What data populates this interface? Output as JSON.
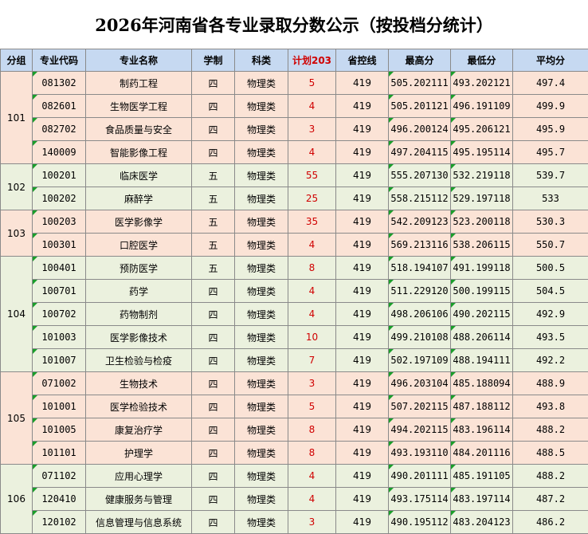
{
  "title": "2026年河南省各专业录取分数公示（按投档分统计）",
  "headers": [
    "分组",
    "专业代码",
    "专业名称",
    "学制",
    "科类",
    "计划203",
    "省控线",
    "最高分",
    "最低分",
    "平均分"
  ],
  "groups": [
    {
      "id": "101",
      "rows": [
        {
          "code": "081302",
          "name": "制药工程",
          "years": "四",
          "subject": "物理类",
          "plan": "5",
          "line": "419",
          "max": "505.202111",
          "min": "493.202121",
          "avg": "497.4"
        },
        {
          "code": "082601",
          "name": "生物医学工程",
          "years": "四",
          "subject": "物理类",
          "plan": "4",
          "line": "419",
          "max": "505.201121",
          "min": "496.191109",
          "avg": "499.9"
        },
        {
          "code": "082702",
          "name": "食品质量与安全",
          "years": "四",
          "subject": "物理类",
          "plan": "3",
          "line": "419",
          "max": "496.200124",
          "min": "495.206121",
          "avg": "495.9"
        },
        {
          "code": "140009",
          "name": "智能影像工程",
          "years": "四",
          "subject": "物理类",
          "plan": "4",
          "line": "419",
          "max": "497.204115",
          "min": "495.195114",
          "avg": "495.7"
        }
      ]
    },
    {
      "id": "102",
      "rows": [
        {
          "code": "100201",
          "name": "临床医学",
          "years": "五",
          "subject": "物理类",
          "plan": "55",
          "line": "419",
          "max": "555.207130",
          "min": "532.219118",
          "avg": "539.7"
        },
        {
          "code": "100202",
          "name": "麻醉学",
          "years": "五",
          "subject": "物理类",
          "plan": "25",
          "line": "419",
          "max": "558.215112",
          "min": "529.197118",
          "avg": "533"
        }
      ]
    },
    {
      "id": "103",
      "rows": [
        {
          "code": "100203",
          "name": "医学影像学",
          "years": "五",
          "subject": "物理类",
          "plan": "35",
          "line": "419",
          "max": "542.209123",
          "min": "523.200118",
          "avg": "530.3"
        },
        {
          "code": "100301",
          "name": "口腔医学",
          "years": "五",
          "subject": "物理类",
          "plan": "4",
          "line": "419",
          "max": "569.213116",
          "min": "538.206115",
          "avg": "550.7"
        }
      ]
    },
    {
      "id": "104",
      "rows": [
        {
          "code": "100401",
          "name": "预防医学",
          "years": "五",
          "subject": "物理类",
          "plan": "8",
          "line": "419",
          "max": "518.194107",
          "min": "491.199118",
          "avg": "500.5"
        },
        {
          "code": "100701",
          "name": "药学",
          "years": "四",
          "subject": "物理类",
          "plan": "4",
          "line": "419",
          "max": "511.229120",
          "min": "500.199115",
          "avg": "504.5"
        },
        {
          "code": "100702",
          "name": "药物制剂",
          "years": "四",
          "subject": "物理类",
          "plan": "4",
          "line": "419",
          "max": "498.206106",
          "min": "490.202115",
          "avg": "492.9"
        },
        {
          "code": "101003",
          "name": "医学影像技术",
          "years": "四",
          "subject": "物理类",
          "plan": "10",
          "line": "419",
          "max": "499.210108",
          "min": "488.206114",
          "avg": "493.5"
        },
        {
          "code": "101007",
          "name": "卫生检验与检疫",
          "years": "四",
          "subject": "物理类",
          "plan": "7",
          "line": "419",
          "max": "502.197109",
          "min": "488.194111",
          "avg": "492.2"
        }
      ]
    },
    {
      "id": "105",
      "rows": [
        {
          "code": "071002",
          "name": "生物技术",
          "years": "四",
          "subject": "物理类",
          "plan": "3",
          "line": "419",
          "max": "496.203104",
          "min": "485.188094",
          "avg": "488.9"
        },
        {
          "code": "101001",
          "name": "医学检验技术",
          "years": "四",
          "subject": "物理类",
          "plan": "5",
          "line": "419",
          "max": "507.202115",
          "min": "487.188112",
          "avg": "493.8"
        },
        {
          "code": "101005",
          "name": "康复治疗学",
          "years": "四",
          "subject": "物理类",
          "plan": "8",
          "line": "419",
          "max": "494.202115",
          "min": "483.196114",
          "avg": "488.2"
        },
        {
          "code": "101101",
          "name": "护理学",
          "years": "四",
          "subject": "物理类",
          "plan": "8",
          "line": "419",
          "max": "493.193110",
          "min": "484.201116",
          "avg": "488.5"
        }
      ]
    },
    {
      "id": "106",
      "rows": [
        {
          "code": "071102",
          "name": "应用心理学",
          "years": "四",
          "subject": "物理类",
          "plan": "4",
          "line": "419",
          "max": "490.201111",
          "min": "485.191105",
          "avg": "488.2"
        },
        {
          "code": "120410",
          "name": "健康服务与管理",
          "years": "四",
          "subject": "物理类",
          "plan": "4",
          "line": "419",
          "max": "493.175114",
          "min": "483.197114",
          "avg": "487.2"
        },
        {
          "code": "120102",
          "name": "信息管理与信息系统",
          "years": "四",
          "subject": "物理类",
          "plan": "3",
          "line": "419",
          "max": "490.195112",
          "min": "483.204123",
          "avg": "486.2"
        }
      ]
    }
  ]
}
